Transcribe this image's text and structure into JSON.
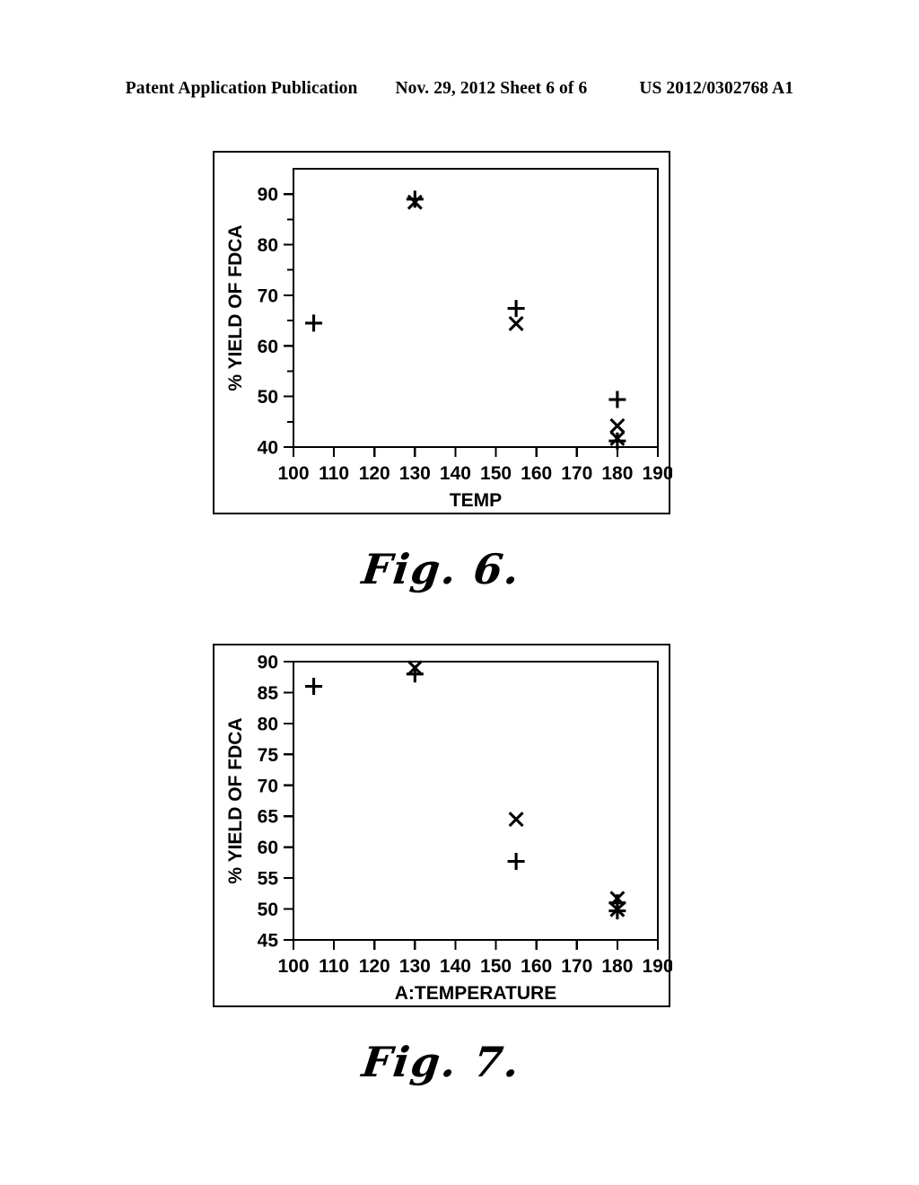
{
  "header": {
    "left": "Patent Application Publication",
    "middle": "Nov. 29, 2012  Sheet 6 of 6",
    "right": "US 2012/0302768 A1"
  },
  "figures": [
    {
      "id": "fig6",
      "caption": "Fig. 6.",
      "chart_data": {
        "type": "scatter",
        "title": "",
        "xlabel": "TEMP",
        "ylabel": "% YIELD OF FDCA",
        "xlim": [
          100,
          190
        ],
        "ylim": [
          40,
          95
        ],
        "xticks": [
          100,
          110,
          120,
          130,
          140,
          150,
          160,
          170,
          180,
          190
        ],
        "yticks": [
          40,
          50,
          60,
          70,
          80,
          90
        ],
        "yminorticks": [
          45,
          55,
          65,
          75,
          85
        ],
        "grid": false,
        "legend": "none",
        "series": [
          {
            "name": "plus",
            "marker": "plus",
            "points": [
              {
                "x": 105,
                "y": 64.5
              },
              {
                "x": 130,
                "y": 89.0
              },
              {
                "x": 155,
                "y": 67.4
              },
              {
                "x": 180,
                "y": 49.4
              },
              {
                "x": 180,
                "y": 41.2
              }
            ]
          },
          {
            "name": "cross",
            "marker": "cross",
            "points": [
              {
                "x": 130,
                "y": 88.4
              },
              {
                "x": 155,
                "y": 64.4
              },
              {
                "x": 180,
                "y": 44.2
              },
              {
                "x": 180,
                "y": 41.7
              }
            ]
          }
        ]
      }
    },
    {
      "id": "fig7",
      "caption": "Fig. 7.",
      "chart_data": {
        "type": "scatter",
        "title": "",
        "xlabel": "A:TEMPERATURE",
        "ylabel": "% YIELD OF FDCA",
        "xlim": [
          100,
          190
        ],
        "ylim": [
          45,
          90
        ],
        "xticks": [
          100,
          110,
          120,
          130,
          140,
          150,
          160,
          170,
          180,
          190
        ],
        "yticks": [
          45,
          50,
          55,
          60,
          65,
          70,
          75,
          80,
          85,
          90
        ],
        "yminorticks": [],
        "grid": false,
        "legend": "none",
        "series": [
          {
            "name": "plus",
            "marker": "plus",
            "points": [
              {
                "x": 105,
                "y": 86.0
              },
              {
                "x": 130,
                "y": 88.0
              },
              {
                "x": 155,
                "y": 57.7
              },
              {
                "x": 180,
                "y": 51.0
              },
              {
                "x": 180,
                "y": 49.7
              }
            ]
          },
          {
            "name": "cross",
            "marker": "cross",
            "points": [
              {
                "x": 130,
                "y": 89.0
              },
              {
                "x": 155,
                "y": 64.5
              },
              {
                "x": 180,
                "y": 51.7
              },
              {
                "x": 180,
                "y": 49.9
              }
            ]
          }
        ]
      }
    }
  ]
}
